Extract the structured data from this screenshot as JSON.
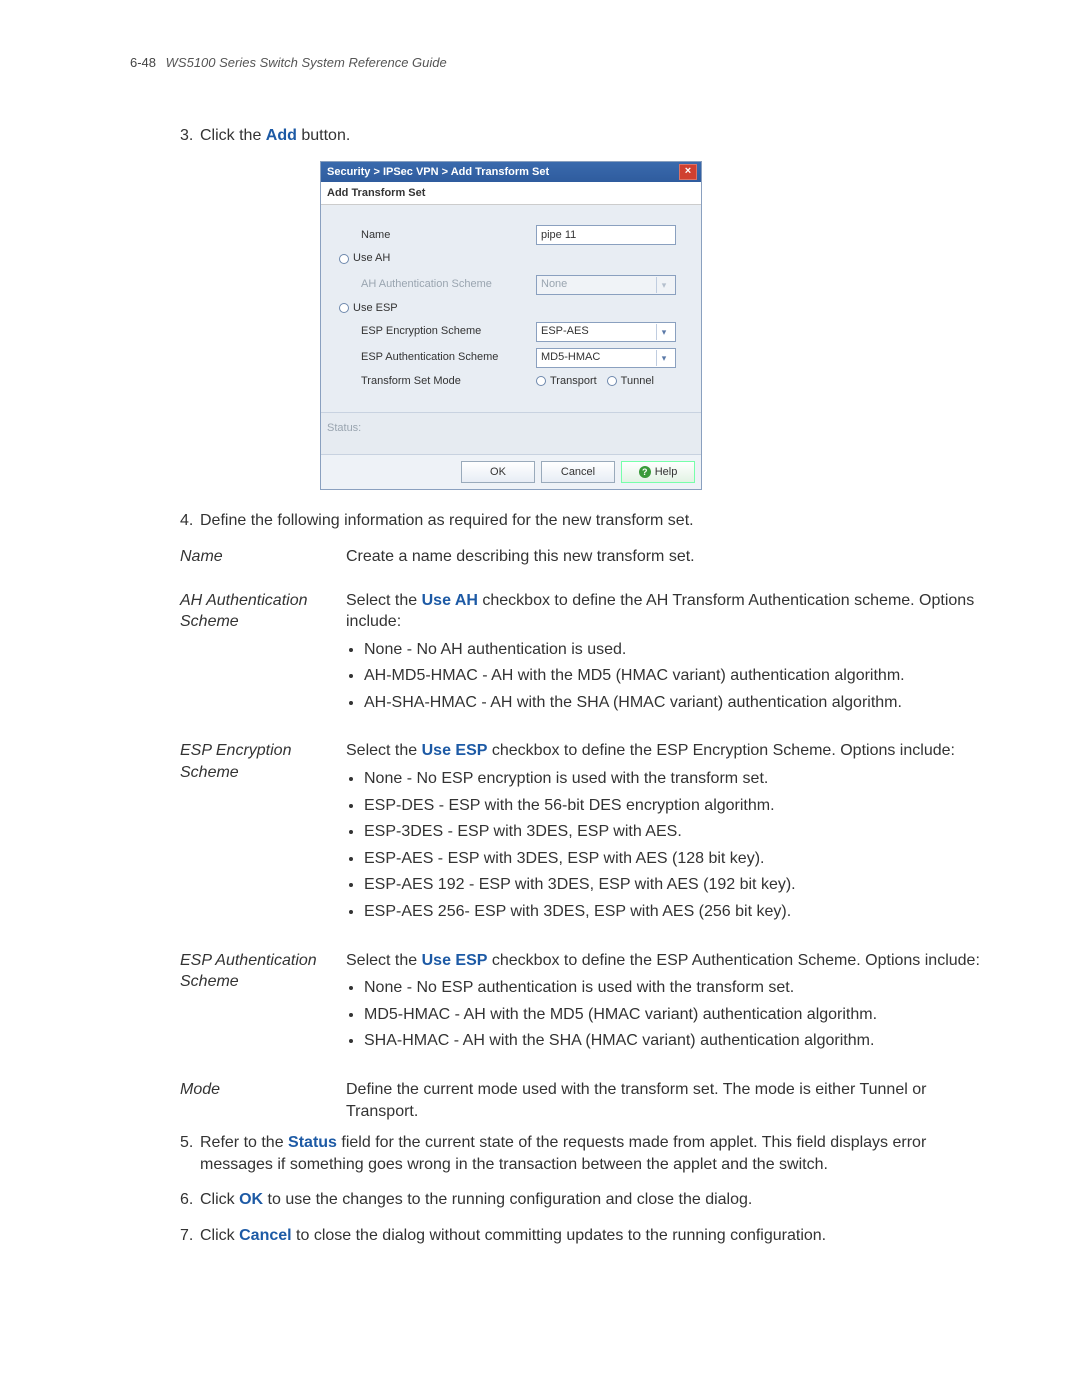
{
  "header": {
    "page": "6-48",
    "title": "WS5100 Series Switch System Reference Guide"
  },
  "steps": {
    "s3": {
      "num": "3.",
      "pre": "Click the ",
      "bold": "Add",
      "post": " button."
    },
    "s4": {
      "num": "4.",
      "text": "Define the following information as required for the new transform set."
    },
    "s5": {
      "num": "5.",
      "pre": "Refer to the ",
      "bold": "Status",
      "post": " field for the current state of the requests made from applet. This field displays error messages if something goes wrong in the transaction between the applet and the switch."
    },
    "s6": {
      "num": "6.",
      "pre": "Click ",
      "bold": "OK",
      "post": " to use the changes to the running configuration and close the dialog."
    },
    "s7": {
      "num": "7.",
      "pre": "Click ",
      "bold": "Cancel",
      "post": " to close the dialog without committing updates to the running configuration."
    }
  },
  "dialog": {
    "breadcrumb": "Security > IPSec VPN > Add Transform Set",
    "sectionTitle": "Add Transform Set",
    "labels": {
      "name": "Name",
      "useAH": "Use AH",
      "ahAuth": "AH Authentication Scheme",
      "useESP": "Use ESP",
      "espEnc": "ESP Encryption Scheme",
      "espAuth": "ESP Authentication Scheme",
      "mode": "Transform Set Mode",
      "transport": "Transport",
      "tunnel": "Tunnel"
    },
    "values": {
      "name": "pipe 11",
      "ahAuth": "None",
      "espEnc": "ESP-AES",
      "espAuth": "MD5-HMAC"
    },
    "status": "Status:",
    "buttons": {
      "ok": "OK",
      "cancel": "Cancel",
      "help": "Help"
    }
  },
  "defs": {
    "name": {
      "term": "Name",
      "desc": "Create a name describing this new transform set."
    },
    "ahAuth": {
      "term": "AH Authentication Scheme",
      "intro_pre": "Select the ",
      "intro_bold": "Use AH",
      "intro_post": " checkbox to define the AH Transform Authentication scheme. Options include:",
      "items": [
        "None - No AH authentication is used.",
        "AH-MD5-HMAC - AH with the MD5 (HMAC variant) authentication algorithm.",
        "AH-SHA-HMAC - AH with the SHA (HMAC variant) authentication algorithm."
      ]
    },
    "espEnc": {
      "term": "ESP Encryption Scheme",
      "intro_pre": "Select the ",
      "intro_bold": "Use ESP",
      "intro_post": " checkbox to define the ESP Encryption Scheme. Options include:",
      "items": [
        "None - No ESP encryption is used with the transform set.",
        "ESP-DES - ESP with the 56-bit DES encryption algorithm.",
        "ESP-3DES - ESP with 3DES, ESP with AES.",
        "ESP-AES - ESP with 3DES, ESP with AES (128 bit key).",
        "ESP-AES 192 - ESP with 3DES, ESP with AES (192 bit key).",
        "ESP-AES 256- ESP with 3DES, ESP with AES (256 bit key)."
      ]
    },
    "espAuth": {
      "term": "ESP Authentication Scheme",
      "intro_pre": "Select the ",
      "intro_bold": "Use ESP",
      "intro_post": " checkbox to define the ESP Authentication Scheme. Options include:",
      "items": [
        "None - No ESP authentication is used with the transform set.",
        "MD5-HMAC - AH with the MD5 (HMAC variant) authentication algorithm.",
        "SHA-HMAC - AH with the SHA (HMAC variant) authentication algorithm."
      ]
    },
    "mode": {
      "term": "Mode",
      "desc": "Define the current mode used with the transform set. The mode is either Tunnel or Transport."
    }
  }
}
